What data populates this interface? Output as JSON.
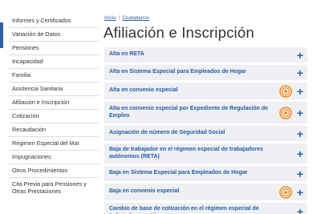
{
  "breadcrumb": {
    "items": [
      "Inicio",
      "Ciudadanos"
    ],
    "separator": "/"
  },
  "page": {
    "title": "Afiliación e Inscripción"
  },
  "sidebar": {
    "items": [
      {
        "label": "Informes y Certificados"
      },
      {
        "label": "Variación de Datos"
      },
      {
        "label": "Pensiones"
      },
      {
        "label": "Incapacidad"
      },
      {
        "label": "Familia"
      },
      {
        "label": "Asistencia Sanitaria"
      },
      {
        "label": "Afiliación e Inscripción"
      },
      {
        "label": "Cotización"
      },
      {
        "label": "Recaudación"
      },
      {
        "label": "Régimen Especial del Mar"
      },
      {
        "label": "Impugnaciones"
      },
      {
        "label": "Otros Procedimientos"
      },
      {
        "label": "Cita Previa para Pensiones y Otras Prestaciones"
      }
    ]
  },
  "accordion": {
    "items": [
      {
        "label": "Alta en RETA",
        "electronic": false
      },
      {
        "label": "Alta en Sistema Especial para Empleados de Hogar",
        "electronic": false
      },
      {
        "label": "Alta en convenio especial",
        "electronic": true
      },
      {
        "label": "Alta en convenio especial por Expediente de Regulación de Empleo",
        "electronic": true
      },
      {
        "label": "Asignación de número de Seguridad Social",
        "electronic": false
      },
      {
        "label": "Baja de trabajador en el régimen especial de trabajadores autónomos (RETA)",
        "electronic": false
      },
      {
        "label": "Baja en Sistema Especial  para Empleados de Hogar",
        "electronic": false
      },
      {
        "label": "Baja en convenio especial",
        "electronic": true
      },
      {
        "label": "Cambio de base de cotización en el régimen especial de trabajadores autónomos",
        "electronic": false
      }
    ],
    "expand_symbol": "+",
    "electronic_icon": "at-sign-electronic-service-icon"
  },
  "colors": {
    "accent": "#2f5fa6",
    "item_background": "#eef0f3",
    "item_text": "#245ba5",
    "electronic_icon": "#f08a1c"
  }
}
